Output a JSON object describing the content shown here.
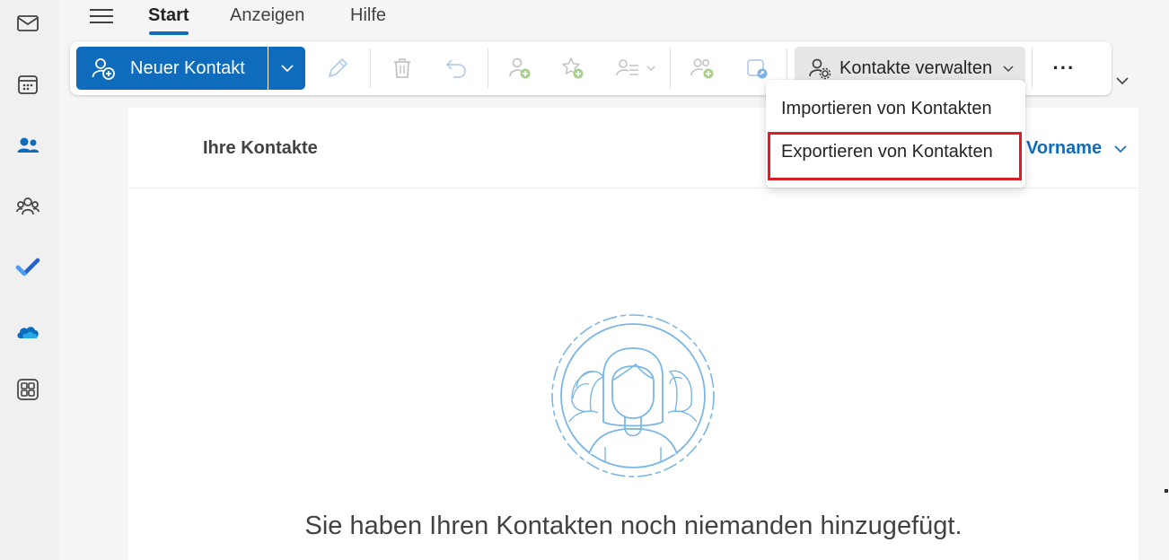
{
  "nav_rail": {
    "items": [
      {
        "name": "mail-icon"
      },
      {
        "name": "calendar-icon"
      },
      {
        "name": "people-icon"
      },
      {
        "name": "groups-icon"
      },
      {
        "name": "todo-icon"
      },
      {
        "name": "onedrive-icon"
      },
      {
        "name": "apps-icon"
      }
    ]
  },
  "tabs": {
    "start": "Start",
    "anzeigen": "Anzeigen",
    "hilfe": "Hilfe"
  },
  "toolbar": {
    "new_contact_label": "Neuer Kontakt",
    "manage_contacts_label": "Kontakte verwalten",
    "more_label": "···"
  },
  "dropdown_menu": {
    "items": [
      "Importieren von Kontakten",
      "Exportieren von Kontakten"
    ]
  },
  "content": {
    "your_contacts": "Ihre Kontakte",
    "sort_label": "Vorname",
    "empty_message": "Sie haben Ihren Kontakten noch niemanden hinzugefügt."
  },
  "colors": {
    "accent": "#0f6cbd",
    "highlight_border": "#d81e26"
  }
}
